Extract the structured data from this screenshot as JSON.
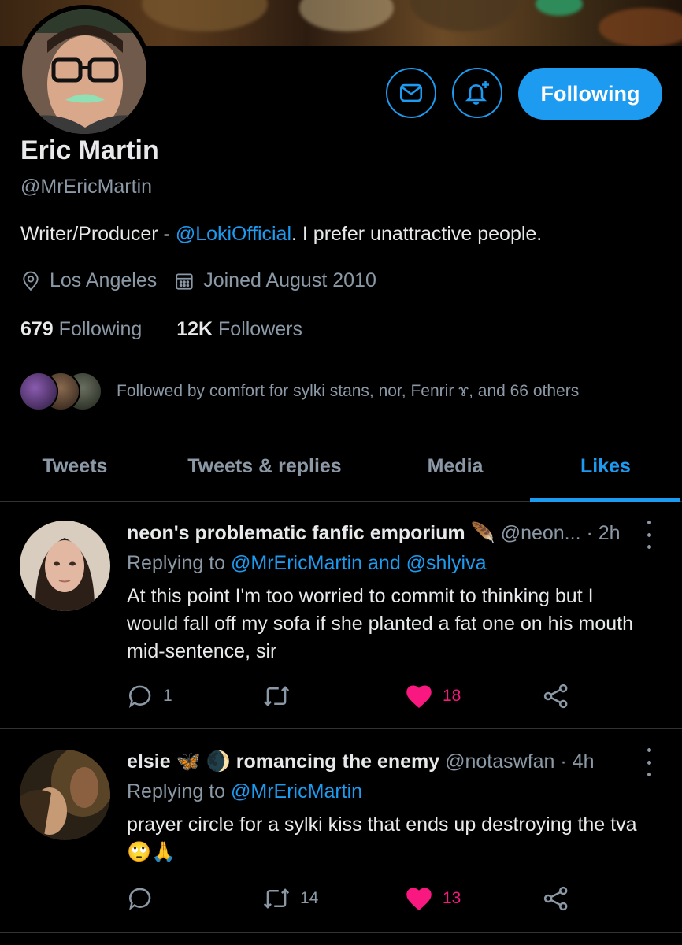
{
  "profile": {
    "name": "Eric Martin",
    "handle": "@MrEricMartin",
    "bio_prefix": "Writer/Producer - ",
    "bio_link": "@LokiOfficial",
    "bio_suffix": ". I prefer unattractive people.",
    "location": "Los Angeles",
    "joined": "Joined August 2010",
    "following_count": "679",
    "following_label": "Following",
    "followers_count": "12K",
    "followers_label": "Followers",
    "followed_by": "Followed by comfort for sylki stans, nor, Fenrir ɤ, and 66 others",
    "follow_button": "Following"
  },
  "icons": {
    "message": "mail-icon",
    "notify": "bell-plus-icon",
    "location": "location-pin-icon",
    "calendar": "calendar-icon",
    "reply": "reply-icon",
    "retweet": "retweet-icon",
    "like": "heart-icon",
    "share": "share-icon",
    "more": "more-vertical-icon"
  },
  "colors": {
    "accent": "#1d9bf0",
    "like": "#f91880",
    "muted": "#8b98a5",
    "background": "#000000"
  },
  "tabs": [
    {
      "label": "Tweets"
    },
    {
      "label": "Tweets & replies"
    },
    {
      "label": "Media"
    },
    {
      "label": "Likes",
      "active": true
    }
  ],
  "tweets": [
    {
      "display_name": "neon's problematic fanfic emporium",
      "emoji": "🪶",
      "handle": "@neon...",
      "time": "· 2h",
      "replying_prefix": "Replying to ",
      "replying_to": "@MrEricMartin and @shlyiva",
      "text": "At this point I'm too worried to commit to thinking but I would fall off my sofa if she planted a fat one on his mouth mid-sentence, sir",
      "replies": "1",
      "retweets": "",
      "likes": "18"
    },
    {
      "display_name": "elsie",
      "emoji": "🦋",
      "emoji2": "🌒",
      "display_name_suffix": "romancing the enemy",
      "handle": "@notaswfan",
      "time": "· 4h",
      "replying_prefix": "Replying to ",
      "replying_to": "@MrEricMartin",
      "text": "prayer circle for a sylki kiss that ends up destroying the tva",
      "text_emoji": "🙄🙏",
      "replies": "",
      "retweets": "14",
      "likes": "13"
    }
  ]
}
